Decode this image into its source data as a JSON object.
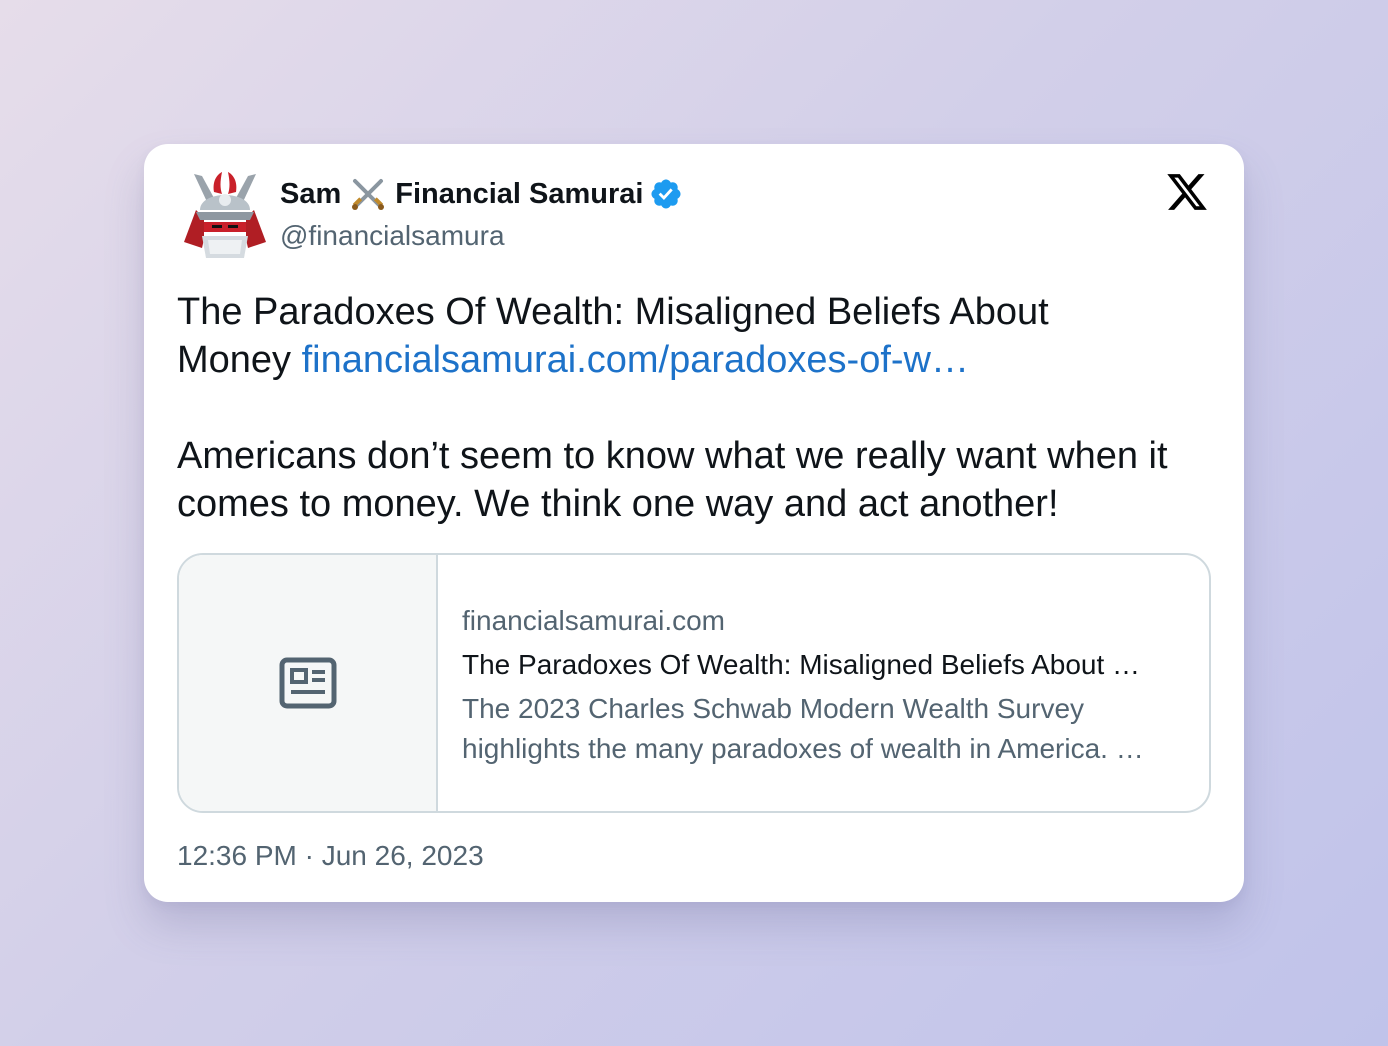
{
  "author": {
    "name_first": "Sam",
    "name_last": "Financial Samurai",
    "handle": "@financialsamura",
    "verified": true,
    "avatar_icon": "samurai-helmet-avatar",
    "name_emoji_icon": "crossed-swords-icon"
  },
  "platform_icon": "x-logo-icon",
  "tweet": {
    "line1": "The Paradoxes Of Wealth: Misaligned Beliefs About",
    "line2_prefix": "Money",
    "link_text": "financialsamurai.com/paradoxes-of-w…",
    "paragraph2": "Americans don’t seem to know what we really want when it comes to money. We think one way and act another!"
  },
  "link_card": {
    "thumb_icon": "newspaper-icon",
    "domain": "financialsamurai.com",
    "title": "The Paradoxes Of Wealth: Misaligned Beliefs About …",
    "description_line1": "The 2023 Charles Schwab Modern Wealth Survey",
    "description_line2": "highlights the many paradoxes of wealth in America. …"
  },
  "timestamp": "12:36 PM · Jun 26, 2023",
  "colors": {
    "link": "#1d72c9",
    "verified_badge": "#1d9bf0",
    "secondary_text": "#536471",
    "primary_text": "#0f1419"
  }
}
